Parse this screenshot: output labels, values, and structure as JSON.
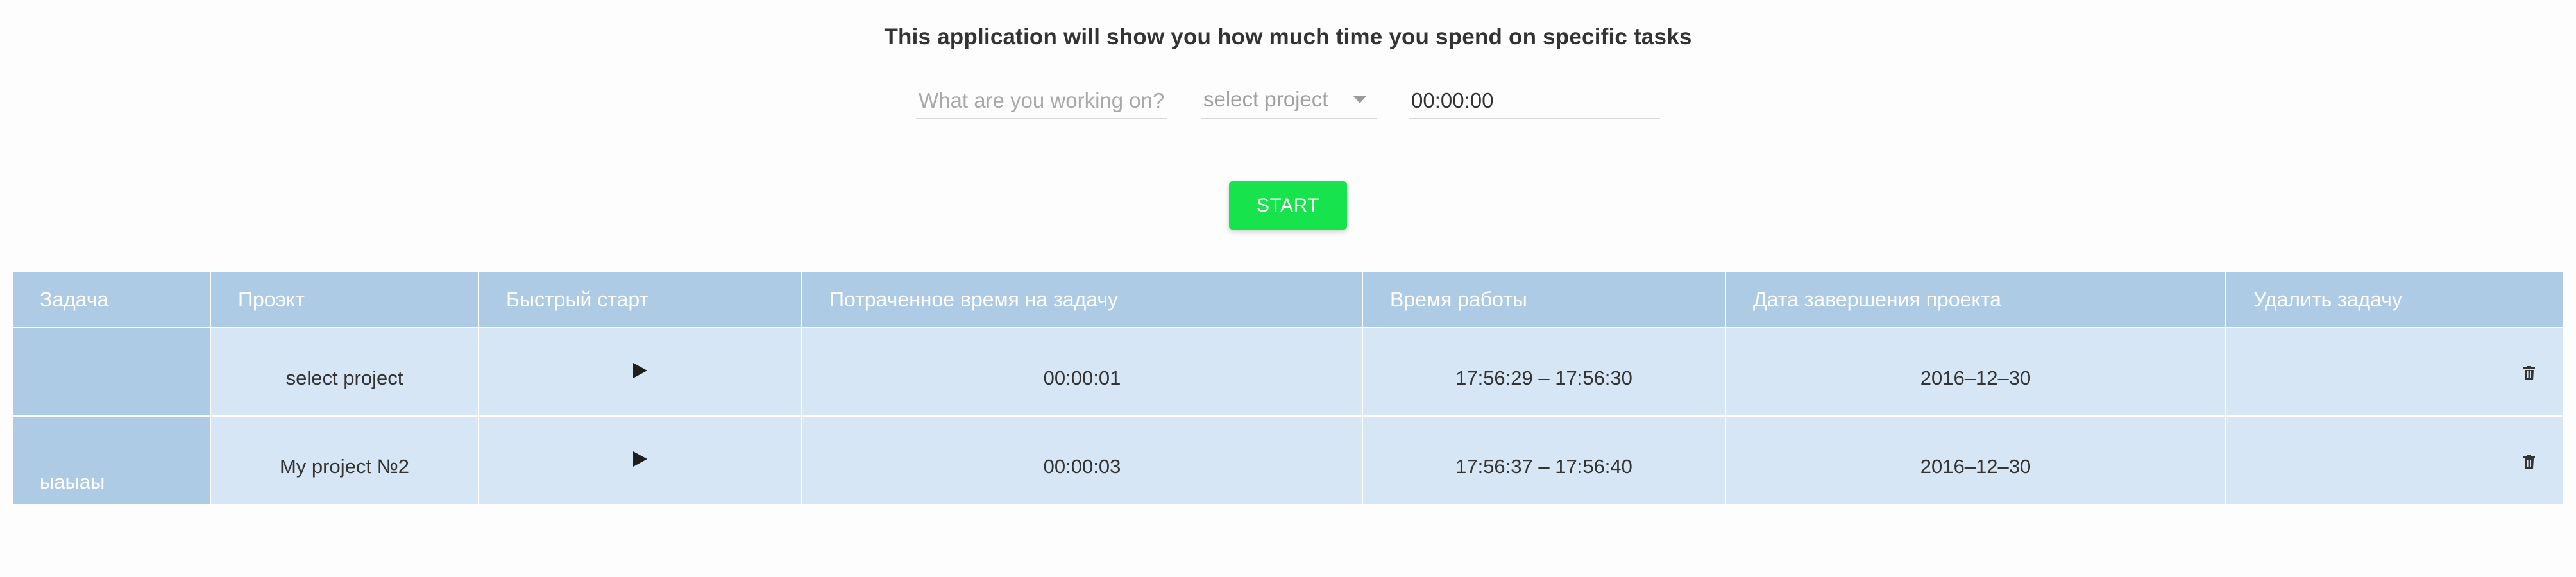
{
  "header": {
    "title": "This application will show you how much time you spend on specific tasks"
  },
  "form": {
    "task_placeholder": "What are you working on?",
    "project_select_value": "select project",
    "timer_value": "00:00:00",
    "start_label": "START"
  },
  "table": {
    "columns": [
      "Задача",
      "Проэкт",
      "Быстрый старт",
      "Потраченное время на задачу",
      "Время работы",
      "Дата завершения проекта",
      "Удалить задачу"
    ],
    "rows": [
      {
        "task": "",
        "project": "select project",
        "time_spent": "00:00:01",
        "work_time": "17:56:29 – 17:56:30",
        "end_date": "2016–12–30"
      },
      {
        "task": "ыаыаы",
        "project": "My project №2",
        "time_spent": "00:00:03",
        "work_time": "17:56:37 – 17:56:40",
        "end_date": "2016–12–30"
      }
    ]
  },
  "icons": {
    "quick_start": "play-icon",
    "delete": "trash-icon",
    "select_caret": "caret-down-icon"
  },
  "colors": {
    "start_button": "#17e34d",
    "table_header": "#aecbe6",
    "table_cell": "#d7e6f4"
  }
}
